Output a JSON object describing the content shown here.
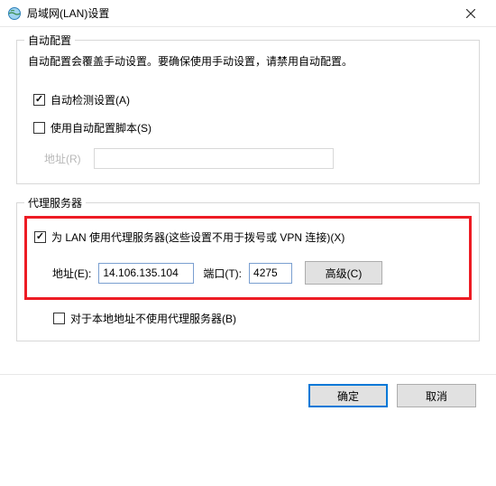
{
  "window": {
    "title": "局域网(LAN)设置"
  },
  "auto_config": {
    "title": "自动配置",
    "description": "自动配置会覆盖手动设置。要确保使用手动设置，请禁用自动配置。",
    "auto_detect": {
      "label": "自动检测设置(A)",
      "checked": true
    },
    "use_script": {
      "label": "使用自动配置脚本(S)",
      "checked": false
    },
    "script_addr_label": "地址(R)",
    "script_addr_value": ""
  },
  "proxy": {
    "title": "代理服务器",
    "use_proxy": {
      "label": "为 LAN 使用代理服务器(这些设置不用于拨号或 VPN 连接)(X)",
      "checked": true
    },
    "addr_label": "地址(E):",
    "addr_value": "14.106.135.104",
    "port_label": "端口(T):",
    "port_value": "4275",
    "advanced_label": "高级(C)",
    "bypass_local": {
      "label": "对于本地地址不使用代理服务器(B)",
      "checked": false
    }
  },
  "buttons": {
    "ok": "确定",
    "cancel": "取消"
  },
  "colors": {
    "highlight": "#ed1c24",
    "input_border_active": "#7a9fd0"
  }
}
